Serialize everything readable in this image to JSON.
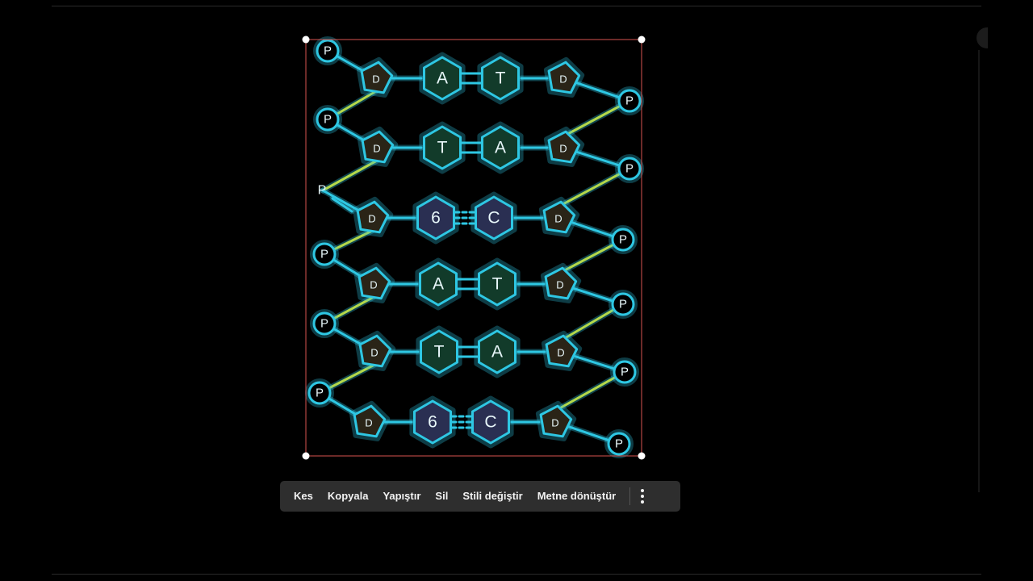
{
  "colors": {
    "background": "#000000",
    "stroke": "#2ec7e3",
    "deoxyribose_fill": "#2a2417",
    "purine_fill": "#123b2a",
    "g_c_fill": "#2a2f52",
    "backbone_highlight": "#b4d84a",
    "selection_border": "#d9534f",
    "toolbar_bg": "#2e2e2e"
  },
  "drawing": {
    "phosphate_label": "P",
    "sugar_label": "D",
    "left_loose_phosphate_label": "P",
    "base_pairs": [
      {
        "left": "A",
        "right": "T",
        "bond": "double"
      },
      {
        "left": "T",
        "right": "A",
        "bond": "double"
      },
      {
        "left": "6",
        "right": "C",
        "bond": "triple"
      },
      {
        "left": "A",
        "right": "T",
        "bond": "double"
      },
      {
        "left": "T",
        "right": "A",
        "bond": "double"
      },
      {
        "left": "6",
        "right": "C",
        "bond": "triple"
      }
    ]
  },
  "context_menu": {
    "cut": "Kes",
    "copy": "Kopyala",
    "paste": "Yapıştır",
    "delete": "Sil",
    "change_style": "Stili değiştir",
    "convert_to_text": "Metne dönüştür",
    "more_icon": "more-vertical-icon"
  }
}
